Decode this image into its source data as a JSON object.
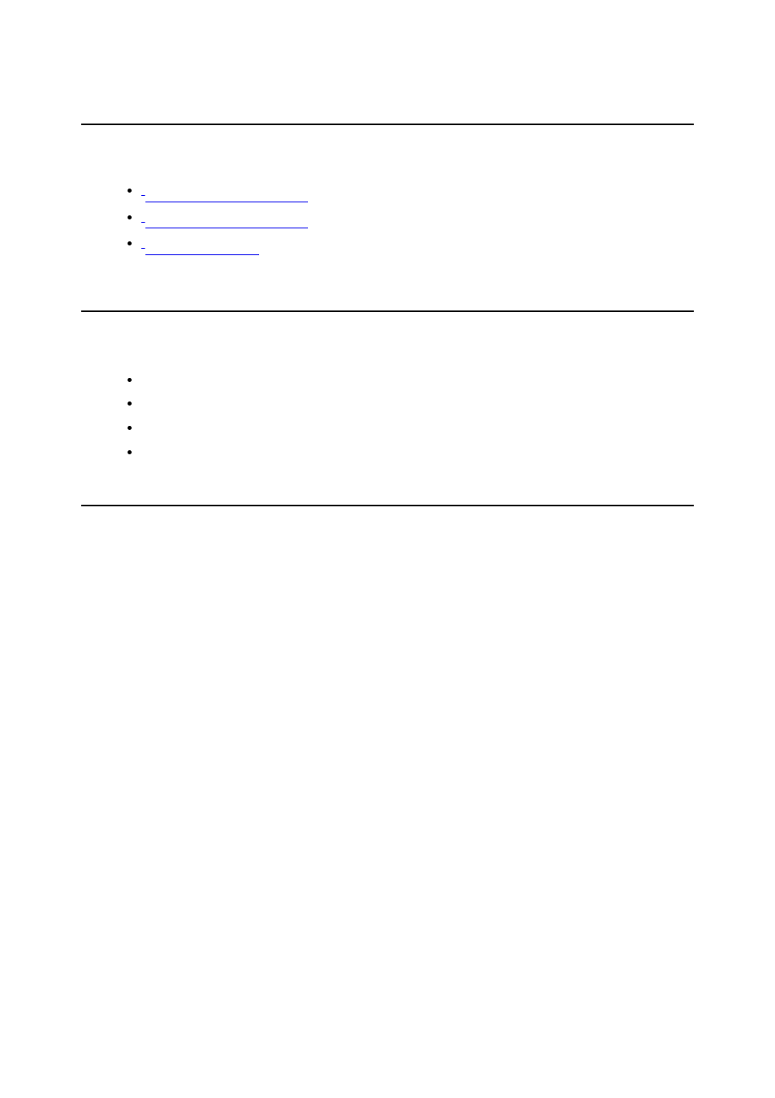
{
  "links_section": {
    "items": [
      {
        "label": " "
      },
      {
        "label": " "
      },
      {
        "label": " "
      }
    ]
  },
  "bullets_section": {
    "items": [
      {
        "label": ""
      },
      {
        "label": ""
      },
      {
        "label": ""
      },
      {
        "label": ""
      }
    ]
  }
}
